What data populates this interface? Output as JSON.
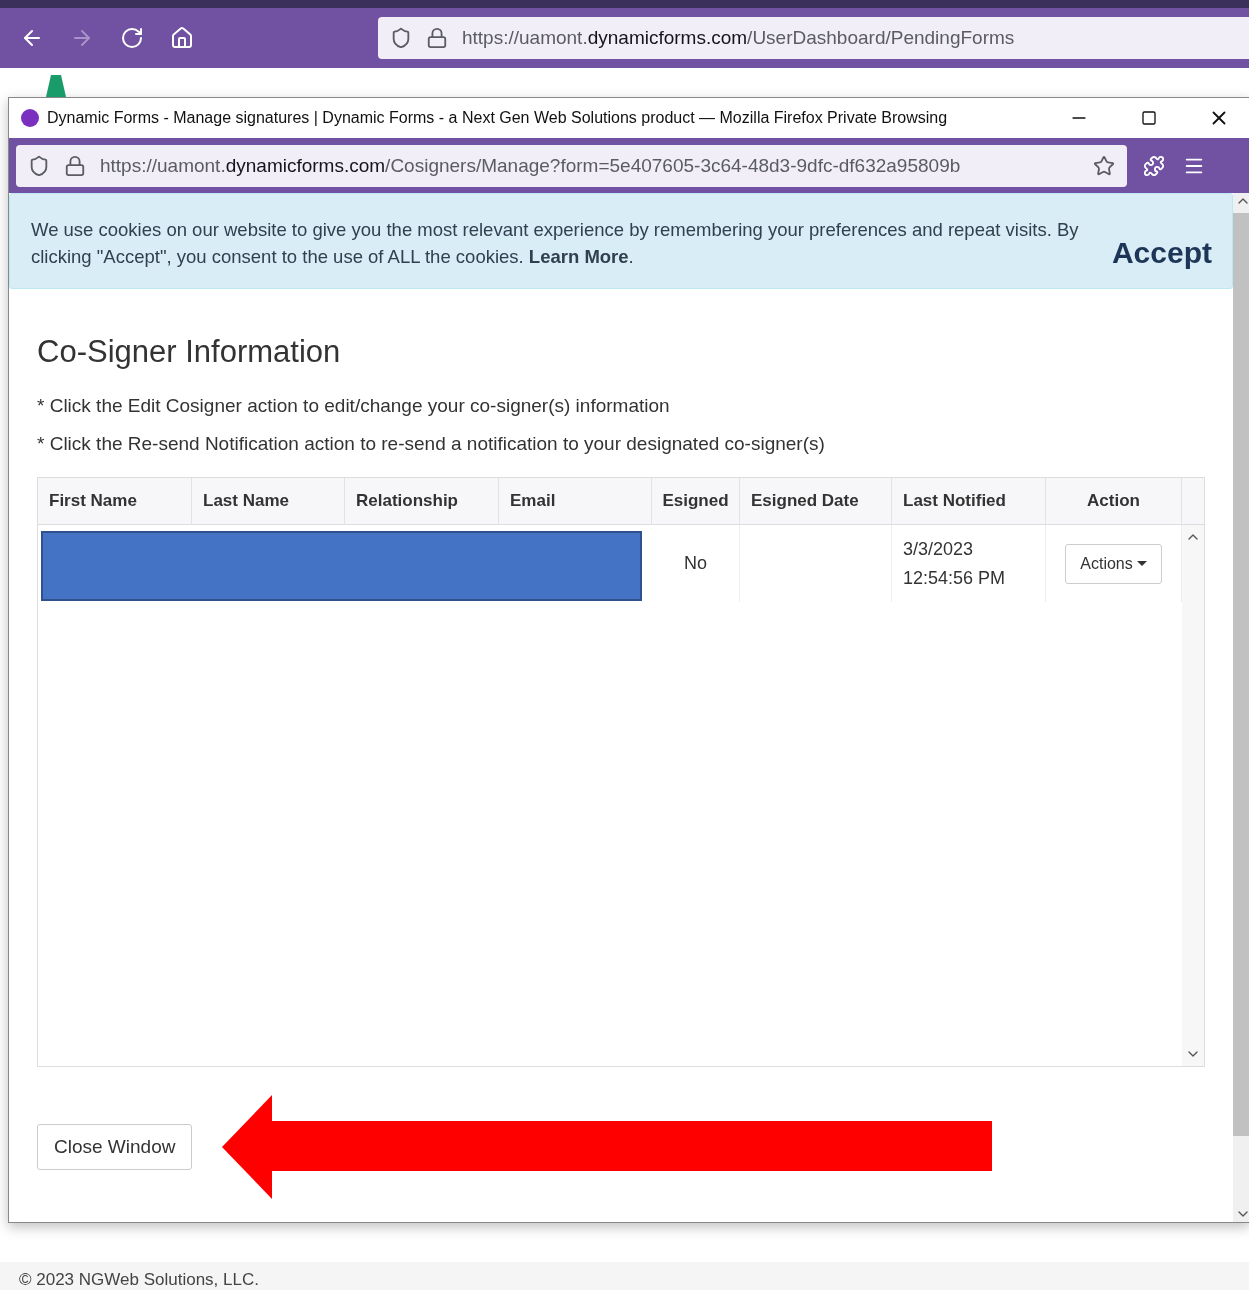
{
  "browser": {
    "url": {
      "scheme": "https://uamont.",
      "domain": "dynamicforms.com",
      "path": "/UserDashboard/PendingForms"
    },
    "forward_disabled": true
  },
  "popup": {
    "title": "Dynamic Forms - Manage signatures | Dynamic Forms - a Next Gen Web Solutions product — Mozilla Firefox Private Browsing",
    "url": {
      "scheme": "https://uamont.",
      "domain": "dynamicforms.com",
      "path": "/Cosigners/Manage?form=5e407605-3c64-48d3-9dfc-df632a95809b"
    }
  },
  "cookie_banner": {
    "text": "We use cookies on our website to give you the most relevant experience by remembering your preferences and repeat visits. By clicking \"Accept\", you consent to the use of ALL the cookies. **Learn More**.",
    "accept": "Accept"
  },
  "heading": "Co-Signer Information",
  "instructions": [
    "* Click the Edit Cosigner action to edit/change your co-signer(s) information",
    "* Click the Re-send Notification action to re-send a notification to your designated co-signer(s)"
  ],
  "table": {
    "columns": [
      "First Name",
      "Last Name",
      "Relationship",
      "Email",
      "Esigned",
      "Esigned Date",
      "Last Notified",
      "Action"
    ],
    "rows": [
      {
        "redacted": true,
        "esigned": "No",
        "last_notified": "3/3/2023 12:54:56 PM",
        "action": "Actions"
      }
    ]
  },
  "close_button": "Close Window",
  "footer": "© 2023 NGWeb Solutions, LLC."
}
